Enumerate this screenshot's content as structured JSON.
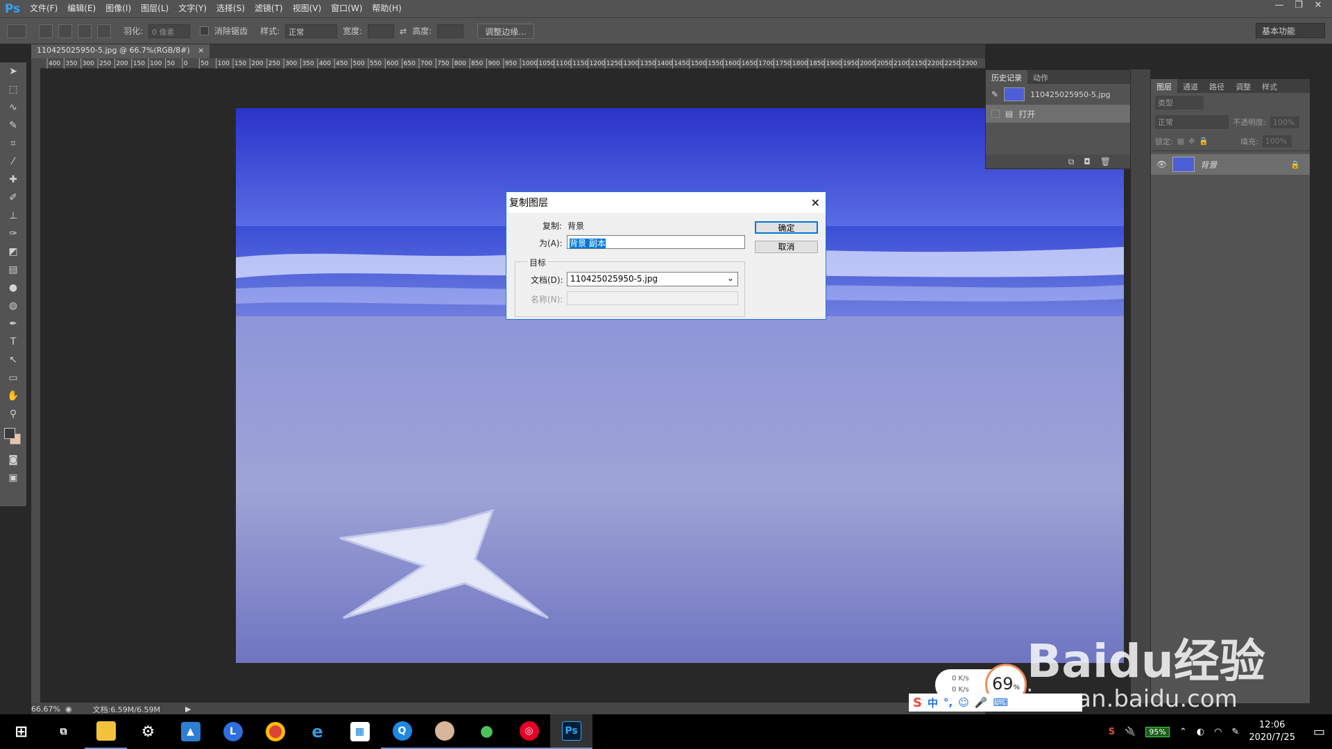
{
  "app": {
    "logo": "Ps"
  },
  "menus": [
    "文件(F)",
    "编辑(E)",
    "图像(I)",
    "图层(L)",
    "文字(Y)",
    "选择(S)",
    "滤镜(T)",
    "视图(V)",
    "窗口(W)",
    "帮助(H)"
  ],
  "window_controls": {
    "minimize": "—",
    "restore": "❐",
    "close": "✕"
  },
  "options": {
    "feather_label": "羽化:",
    "feather_value": "0 像素",
    "antialias_label": "消除锯齿",
    "style_label": "样式:",
    "style_value": "正常",
    "width_label": "宽度:",
    "height_label": "高度:",
    "refine_edge": "调整边缘...",
    "workspace": "基本功能"
  },
  "document": {
    "tab_title": "110425025950-5.jpg @ 66.7%(RGB/8#)",
    "tab_close": "×"
  },
  "ruler": {
    "h_ticks": [
      "400",
      "350",
      "300",
      "250",
      "200",
      "150",
      "100",
      "50",
      "0",
      "50",
      "100",
      "150",
      "200",
      "250",
      "300",
      "350",
      "400",
      "450",
      "500",
      "550",
      "600",
      "650",
      "700",
      "750",
      "800",
      "850",
      "900",
      "950",
      "1000",
      "1050",
      "1100",
      "1150",
      "1200",
      "1250",
      "1300",
      "1350",
      "1400",
      "1450",
      "1500",
      "1550",
      "1600",
      "1650",
      "1700",
      "1750",
      "1800",
      "1850",
      "1900",
      "1950",
      "2000",
      "2050",
      "2100",
      "2150",
      "2200",
      "2250",
      "2300"
    ]
  },
  "status": {
    "zoom": "66.67%",
    "doc_size": "文档:6.59M/6.59M"
  },
  "history": {
    "tabs": [
      "历史记录",
      "动作"
    ],
    "snapshot": "110425025950-5.jpg",
    "item": "打开"
  },
  "layers": {
    "tabs": [
      "图层",
      "通道",
      "路径",
      "调整",
      "样式"
    ],
    "filter": "类型",
    "blend": "正常",
    "opacity_label": "不透明度:",
    "opacity_value": "100%",
    "lock_label": "锁定:",
    "fill_label": "填充:",
    "fill_value": "100%",
    "layer_name": "背景"
  },
  "dialog": {
    "title": "复制图层",
    "duplicate_label": "复制:",
    "duplicate_value": "背景",
    "as_label": "为(A):",
    "as_value": "背景 副本",
    "ok": "确定",
    "cancel": "取消",
    "target_group": "目标",
    "document_label": "文档(D):",
    "document_value": "110425025950-5.jpg",
    "name_label": "名称(N):",
    "close": "✕"
  },
  "taskbar": {
    "time": "12:06",
    "date": "2020/7/25",
    "battery": "95%"
  },
  "speed_widget": {
    "up": "0 K/s",
    "down": "0 K/s",
    "percent": "69",
    "percent_sign": "%"
  },
  "ime": {
    "lang": "中",
    "symbol": "°,"
  },
  "watermark": {
    "brand": "Baidu经验",
    "url": "jingyan.baidu.com"
  },
  "colors": {
    "accent": "#1e7ad3",
    "ps_blue": "#36a2f5"
  }
}
